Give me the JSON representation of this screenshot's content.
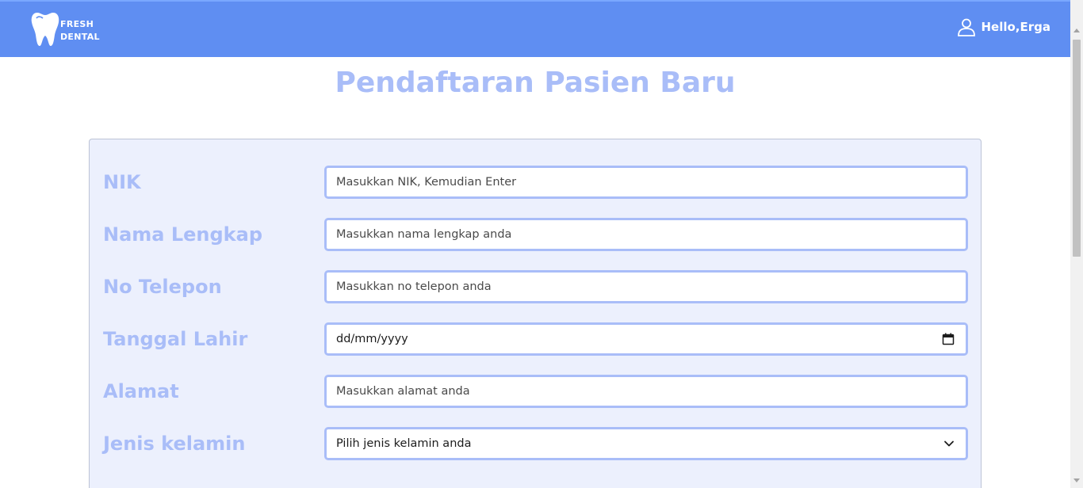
{
  "header": {
    "brand_line1": "FRESH",
    "brand_line2": "DENTAL",
    "greeting": "Hello,Erga",
    "icons": {
      "logo": "tooth-icon",
      "user": "user-icon"
    },
    "bg_color": "#5f8ef2"
  },
  "page": {
    "title": "Pendaftaran Pasien Baru",
    "accent_color": "#a9bdf8"
  },
  "form": {
    "nik": {
      "label": "NIK",
      "placeholder": "Masukkan NIK, Kemudian Enter"
    },
    "nama": {
      "label": "Nama Lengkap",
      "placeholder": "Masukkan nama lengkap anda"
    },
    "telepon": {
      "label": "No Telepon",
      "placeholder": "Masukkan no telepon anda"
    },
    "tanggal": {
      "label": "Tanggal Lahir",
      "value": "dd/mm/yyyy",
      "icon": "calendar-icon"
    },
    "alamat": {
      "label": "Alamat",
      "placeholder": "Masukkan alamat anda"
    },
    "kelamin": {
      "label": "Jenis kelamin",
      "selected": "Pilih jenis kelamin anda",
      "icon": "chevron-down-icon"
    }
  }
}
